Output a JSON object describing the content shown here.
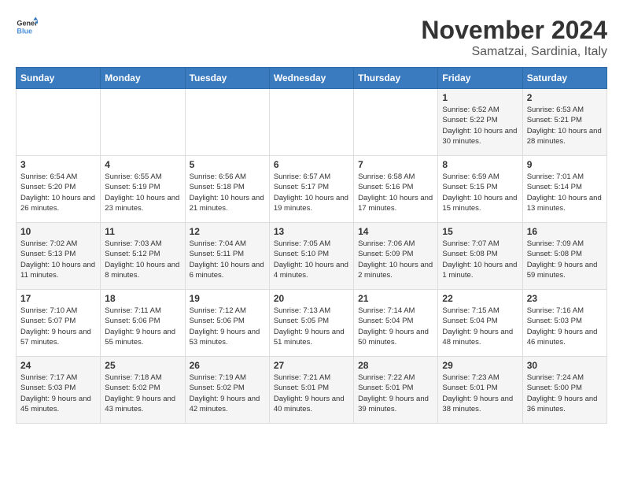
{
  "header": {
    "logo_line1": "General",
    "logo_line2": "Blue",
    "title": "November 2024",
    "subtitle": "Samatzai, Sardinia, Italy"
  },
  "days_of_week": [
    "Sunday",
    "Monday",
    "Tuesday",
    "Wednesday",
    "Thursday",
    "Friday",
    "Saturday"
  ],
  "weeks": [
    [
      {
        "day": "",
        "info": ""
      },
      {
        "day": "",
        "info": ""
      },
      {
        "day": "",
        "info": ""
      },
      {
        "day": "",
        "info": ""
      },
      {
        "day": "",
        "info": ""
      },
      {
        "day": "1",
        "info": "Sunrise: 6:52 AM\nSunset: 5:22 PM\nDaylight: 10 hours and 30 minutes."
      },
      {
        "day": "2",
        "info": "Sunrise: 6:53 AM\nSunset: 5:21 PM\nDaylight: 10 hours and 28 minutes."
      }
    ],
    [
      {
        "day": "3",
        "info": "Sunrise: 6:54 AM\nSunset: 5:20 PM\nDaylight: 10 hours and 26 minutes."
      },
      {
        "day": "4",
        "info": "Sunrise: 6:55 AM\nSunset: 5:19 PM\nDaylight: 10 hours and 23 minutes."
      },
      {
        "day": "5",
        "info": "Sunrise: 6:56 AM\nSunset: 5:18 PM\nDaylight: 10 hours and 21 minutes."
      },
      {
        "day": "6",
        "info": "Sunrise: 6:57 AM\nSunset: 5:17 PM\nDaylight: 10 hours and 19 minutes."
      },
      {
        "day": "7",
        "info": "Sunrise: 6:58 AM\nSunset: 5:16 PM\nDaylight: 10 hours and 17 minutes."
      },
      {
        "day": "8",
        "info": "Sunrise: 6:59 AM\nSunset: 5:15 PM\nDaylight: 10 hours and 15 minutes."
      },
      {
        "day": "9",
        "info": "Sunrise: 7:01 AM\nSunset: 5:14 PM\nDaylight: 10 hours and 13 minutes."
      }
    ],
    [
      {
        "day": "10",
        "info": "Sunrise: 7:02 AM\nSunset: 5:13 PM\nDaylight: 10 hours and 11 minutes."
      },
      {
        "day": "11",
        "info": "Sunrise: 7:03 AM\nSunset: 5:12 PM\nDaylight: 10 hours and 8 minutes."
      },
      {
        "day": "12",
        "info": "Sunrise: 7:04 AM\nSunset: 5:11 PM\nDaylight: 10 hours and 6 minutes."
      },
      {
        "day": "13",
        "info": "Sunrise: 7:05 AM\nSunset: 5:10 PM\nDaylight: 10 hours and 4 minutes."
      },
      {
        "day": "14",
        "info": "Sunrise: 7:06 AM\nSunset: 5:09 PM\nDaylight: 10 hours and 2 minutes."
      },
      {
        "day": "15",
        "info": "Sunrise: 7:07 AM\nSunset: 5:08 PM\nDaylight: 10 hours and 1 minute."
      },
      {
        "day": "16",
        "info": "Sunrise: 7:09 AM\nSunset: 5:08 PM\nDaylight: 9 hours and 59 minutes."
      }
    ],
    [
      {
        "day": "17",
        "info": "Sunrise: 7:10 AM\nSunset: 5:07 PM\nDaylight: 9 hours and 57 minutes."
      },
      {
        "day": "18",
        "info": "Sunrise: 7:11 AM\nSunset: 5:06 PM\nDaylight: 9 hours and 55 minutes."
      },
      {
        "day": "19",
        "info": "Sunrise: 7:12 AM\nSunset: 5:06 PM\nDaylight: 9 hours and 53 minutes."
      },
      {
        "day": "20",
        "info": "Sunrise: 7:13 AM\nSunset: 5:05 PM\nDaylight: 9 hours and 51 minutes."
      },
      {
        "day": "21",
        "info": "Sunrise: 7:14 AM\nSunset: 5:04 PM\nDaylight: 9 hours and 50 minutes."
      },
      {
        "day": "22",
        "info": "Sunrise: 7:15 AM\nSunset: 5:04 PM\nDaylight: 9 hours and 48 minutes."
      },
      {
        "day": "23",
        "info": "Sunrise: 7:16 AM\nSunset: 5:03 PM\nDaylight: 9 hours and 46 minutes."
      }
    ],
    [
      {
        "day": "24",
        "info": "Sunrise: 7:17 AM\nSunset: 5:03 PM\nDaylight: 9 hours and 45 minutes."
      },
      {
        "day": "25",
        "info": "Sunrise: 7:18 AM\nSunset: 5:02 PM\nDaylight: 9 hours and 43 minutes."
      },
      {
        "day": "26",
        "info": "Sunrise: 7:19 AM\nSunset: 5:02 PM\nDaylight: 9 hours and 42 minutes."
      },
      {
        "day": "27",
        "info": "Sunrise: 7:21 AM\nSunset: 5:01 PM\nDaylight: 9 hours and 40 minutes."
      },
      {
        "day": "28",
        "info": "Sunrise: 7:22 AM\nSunset: 5:01 PM\nDaylight: 9 hours and 39 minutes."
      },
      {
        "day": "29",
        "info": "Sunrise: 7:23 AM\nSunset: 5:01 PM\nDaylight: 9 hours and 38 minutes."
      },
      {
        "day": "30",
        "info": "Sunrise: 7:24 AM\nSunset: 5:00 PM\nDaylight: 9 hours and 36 minutes."
      }
    ]
  ]
}
